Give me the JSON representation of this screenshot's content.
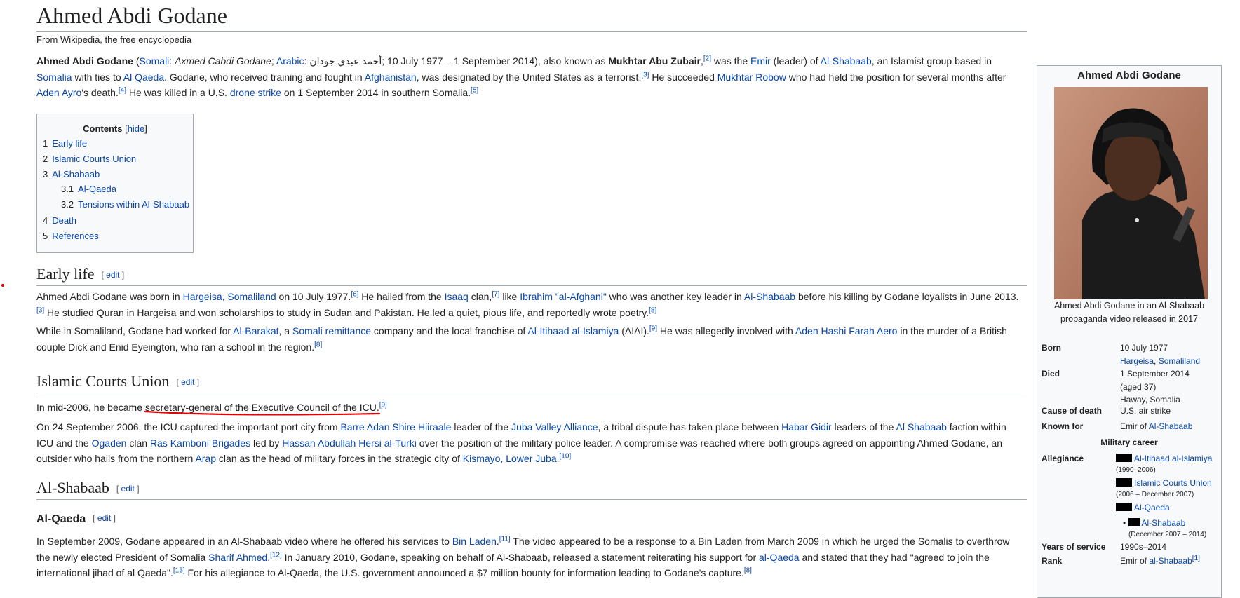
{
  "article": {
    "title": "Ahmed Abdi Godane",
    "tagline": "From Wikipedia, the free encyclopedia"
  },
  "intro": {
    "name": "Ahmed Abdi Godane",
    "open_paren": " (",
    "somali_link": "Somali",
    "somali_sep": ": ",
    "somali_name": "Axmed Cabdi Godane",
    "sep1": "; ",
    "arabic_link": "Arabic",
    "arabic_sep": ": ",
    "arabic_name": "أحمد عبدي جودان",
    "dates": "; 10 July 1977 – 1 September 2014), also known as ",
    "alias": "Mukhtar Abu Zubair",
    "comma": ",",
    "ref2": "[2]",
    "t1": " was the ",
    "emir_link": "Emir",
    "t2": " (leader) of ",
    "shabaab_link": "Al-Shabaab",
    "t3": ", an Islamist group based in ",
    "somalia_link": "Somalia",
    "t4": " with ties to ",
    "alqaeda_link": "Al Qaeda",
    "t5": ". Godane, who received training and fought in ",
    "afghan_link": "Afghanistan",
    "t6": ", was designated by the United States as a terrorist.",
    "ref3": "[3]",
    "t7": " He succeeded ",
    "robow_link": "Mukhtar Robow",
    "t8": " who had held the position for several months after ",
    "ayro_link": "Aden Ayro",
    "t9": "'s death.",
    "ref4": "[4]",
    "t10": " He was killed in a U.S. ",
    "drone_link": "drone strike",
    "t11": " on 1 September 2014 in southern Somalia.",
    "ref5": "[5]"
  },
  "toc": {
    "title": "Contents",
    "hide_open": " [",
    "hide": "hide",
    "hide_close": "]",
    "items": [
      {
        "num": "1",
        "label": "Early life"
      },
      {
        "num": "2",
        "label": "Islamic Courts Union"
      },
      {
        "num": "3",
        "label": "Al-Shabaab"
      },
      {
        "num": "3.1",
        "label": "Al-Qaeda"
      },
      {
        "num": "3.2",
        "label": "Tensions within Al-Shabaab"
      },
      {
        "num": "4",
        "label": "Death"
      },
      {
        "num": "5",
        "label": "References"
      }
    ]
  },
  "edit": {
    "open": "[ ",
    "label": "edit",
    "close": " ]"
  },
  "sections": {
    "early_life": {
      "heading": "Early life",
      "p1": {
        "a": "Ahmed Abdi Godane was born in ",
        "l1": "Hargeisa, Somaliland",
        "b": " on 10 July 1977.",
        "r1": "[6]",
        "c": " He hailed from the ",
        "l2": "Isaaq",
        "d": " clan,",
        "r2": "[7]",
        "e": " like ",
        "l3": "Ibrahim \"al-Afghani\"",
        "f": " who was another key leader in ",
        "l4": "Al-Shabaab",
        "g": " before his killing by Godane loyalists in June 2013.",
        "r3": "[3]",
        "h": " He studied Quran in Hargeisa and won scholarships to study in Sudan and Pakistan. He led a quiet, pious life, and reportedly wrote poetry.",
        "r4": "[8]"
      },
      "p2": {
        "a": "While in Somaliland, Godane had worked for ",
        "l1": "Al-Barakat",
        "b": ", a ",
        "l2": "Somali remittance",
        "c": " company and the local franchise of ",
        "l3": "Al-Itihaad al-Islamiya",
        "d": " (AIAI).",
        "r1": "[9]",
        "e": " He was allegedly involved with ",
        "l4": "Aden Hashi Farah Aero",
        "f": " in the murder of a British couple Dick and Enid Eyeington, who ran a school in the region.",
        "r2": "[8]"
      }
    },
    "icu": {
      "heading": "Islamic Courts Union",
      "p1": {
        "a": "In mid-2006, he became ",
        "highlight": "secretary-general of the Executive Council of the ICU",
        "b": ".",
        "r1": "[9]"
      },
      "p2": {
        "a": "On 24 September 2006, the ICU captured the important port city from ",
        "l1": "Barre Adan Shire Hiiraale",
        "b": " leader of the ",
        "l2": "Juba Valley Alliance",
        "c": ", a tribal dispute has taken place between ",
        "l3": "Habar Gidir",
        "d": " leaders of the ",
        "l4": "Al Shabaab",
        "e": " faction within ICU and the ",
        "l5": "Ogaden",
        "f": " clan ",
        "l6": "Ras Kamboni Brigades",
        "g": " led by ",
        "l7": "Hassan Abdullah Hersi al-Turki",
        "h": " over the position of the military police leader. A compromise was reached where both groups agreed on appointing Ahmed Godane, an outsider who hails from the northern ",
        "l8": "Arap",
        "i": " clan as the head of military forces in the strategic city of ",
        "l9": "Kismayo, Lower Juba",
        "j": ".",
        "r1": "[10]"
      }
    },
    "alshabaab": {
      "heading": "Al-Shabaab"
    },
    "alqaeda": {
      "heading": "Al-Qaeda",
      "p1": {
        "a": "In September 2009, Godane appeared in an Al-Shabaab video where he offered his services to ",
        "l1": "Bin Laden",
        "b": ".",
        "r1": "[11]",
        "c": " The video appeared to be a response to a Bin Laden from March 2009 in which he urged the Somalis to overthrow the newly elected President of Somalia ",
        "l2": "Sharif Ahmed",
        "d": ".",
        "r2": "[12]",
        "e": " In January 2010, Godane, speaking on behalf of Al-Shabaab, released a statement reiterating his support for ",
        "l3": "al-Qaeda",
        "f": " and stated that they had \"agreed to join the international jihad of al Qaeda\".",
        "r3": "[13]",
        "g": " For his allegiance to Al-Qaeda, the U.S. government announced a $7 million bounty for information leading to Godane's capture.",
        "r4": "[8]"
      }
    }
  },
  "infobox": {
    "title": "Ahmed Abdi Godane",
    "caption": "Ahmed Abdi Godane in an Al-Shabaab propaganda video released in 2017",
    "born_label": "Born",
    "born_date": "10 July 1977",
    "born_place_1": "Hargeisa",
    "born_place_sep": ", ",
    "born_place_2": "Somaliland",
    "died_label": "Died",
    "died_date": "1 September 2014",
    "died_age": "(aged 37)",
    "died_place": "Haway, Somalia",
    "cause_label": "Cause of death",
    "cause_value": "U.S. air strike",
    "known_label": "Known for",
    "known_pre": "Emir of ",
    "known_link": "Al-Shabaab",
    "military_career": "Military career",
    "allegiance_label": "Allegiance",
    "allegiances": [
      {
        "name": "Al-Itihaad al-Islamiya",
        "years": "(1990–2006)"
      },
      {
        "name": "Islamic Courts Union",
        "years": "(2006 – December 2007)"
      },
      {
        "name": "Al-Qaeda",
        "years": ""
      },
      {
        "name": "Al-Shabaab",
        "years": "(December 2007 – 2014)"
      }
    ],
    "years_label": "Years of service",
    "years_value": "1990s–2014",
    "rank_label": "Rank",
    "rank_pre": "Emir of ",
    "rank_link": "al-Shabaab",
    "rank_ref": "[1]"
  },
  "colors": {
    "link": "#0645ad",
    "annotation": "#e00000",
    "border": "#a2a9b1",
    "infobox_bg": "#f8f9fa"
  }
}
